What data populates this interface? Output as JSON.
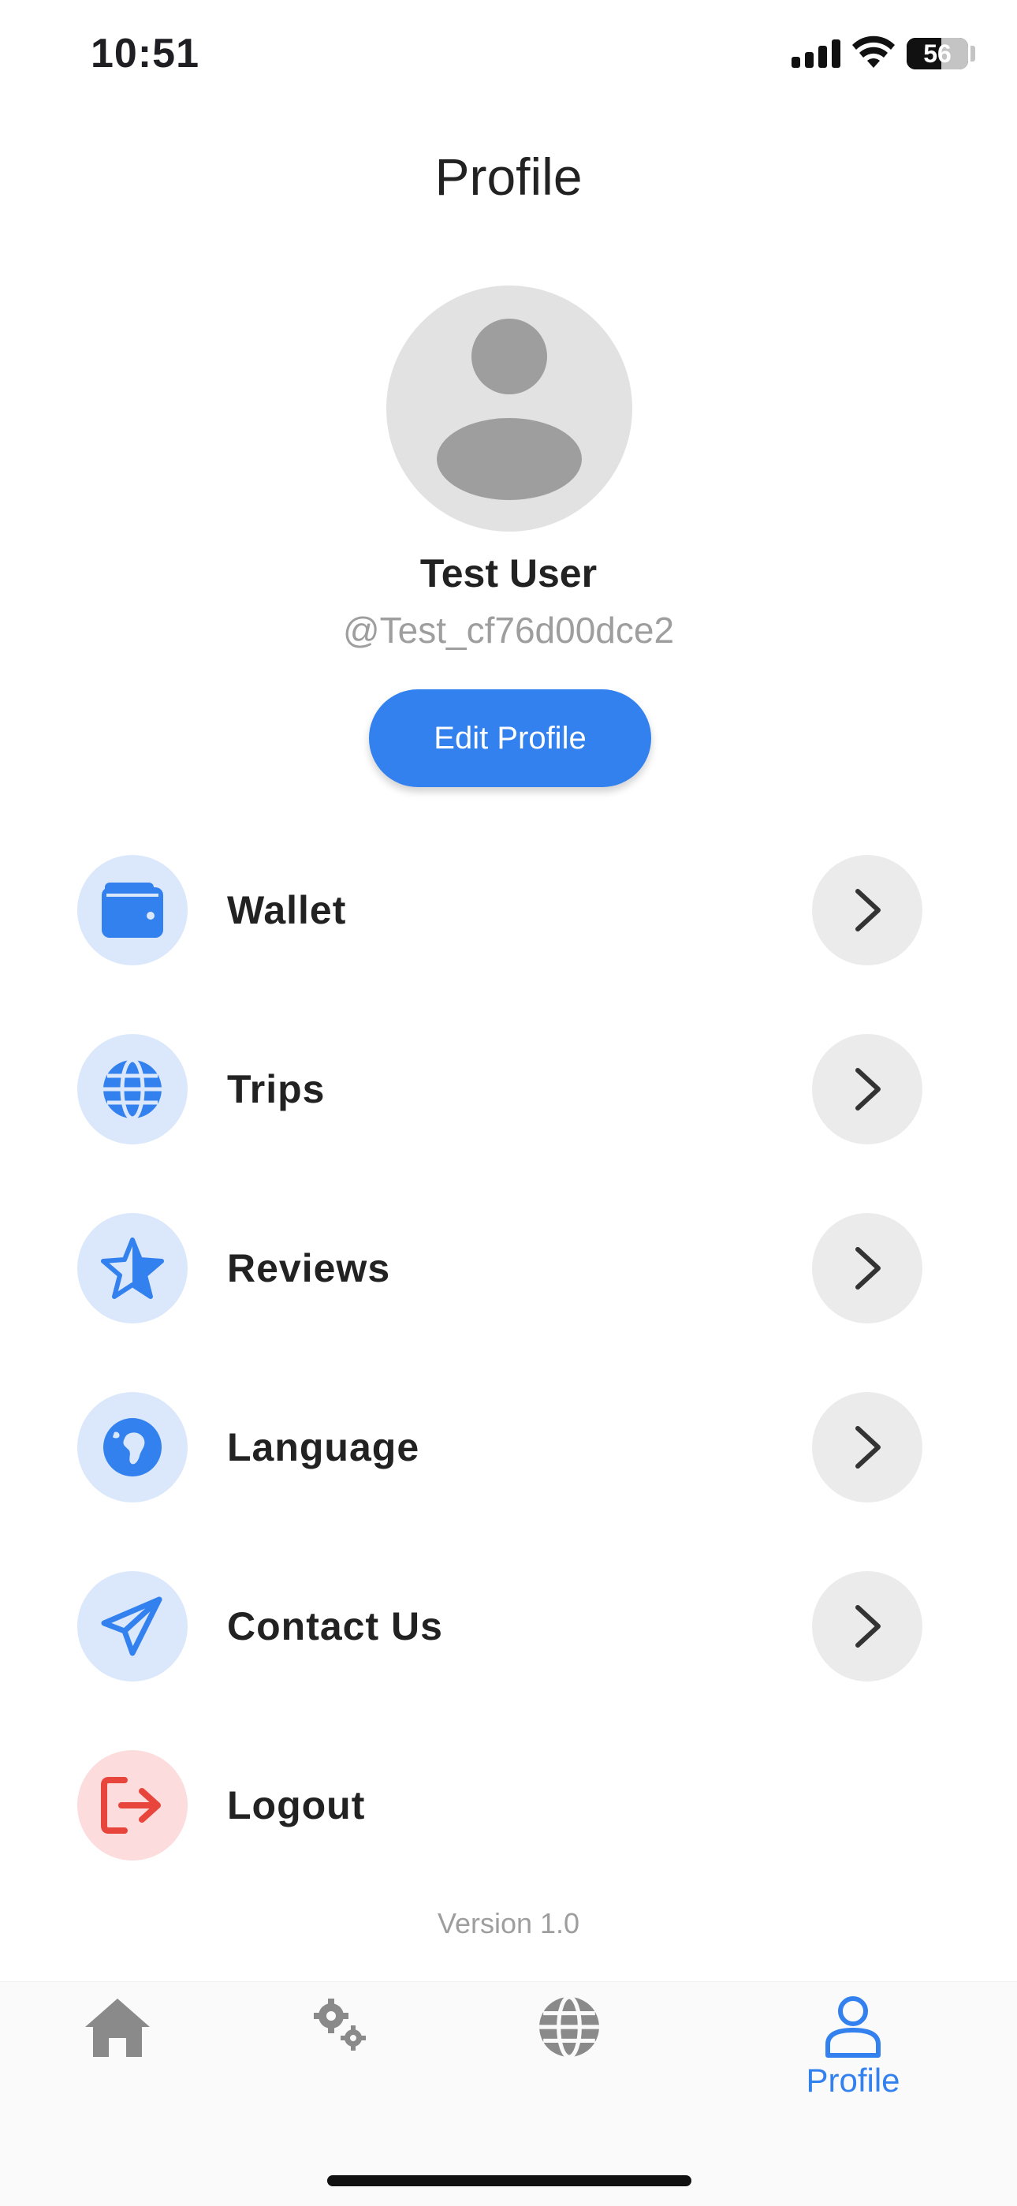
{
  "status_bar": {
    "time": "10:51",
    "battery": "56"
  },
  "header": {
    "title": "Profile"
  },
  "profile": {
    "name": "Test User",
    "handle": "@Test_cf76d00dce2",
    "edit_label": "Edit Profile"
  },
  "menu": {
    "items": [
      {
        "label": "Wallet",
        "icon": "wallet-icon"
      },
      {
        "label": "Trips",
        "icon": "globe-icon"
      },
      {
        "label": "Reviews",
        "icon": "star-icon"
      },
      {
        "label": "Language",
        "icon": "earth-icon"
      },
      {
        "label": "Contact Us",
        "icon": "paper-plane-icon"
      },
      {
        "label": "Logout",
        "icon": "logout-icon"
      }
    ]
  },
  "footer": {
    "version": "Version 1.0"
  },
  "tab_bar": {
    "tabs": [
      {
        "icon": "home-icon",
        "label": ""
      },
      {
        "icon": "gears-icon",
        "label": ""
      },
      {
        "icon": "globe-icon",
        "label": ""
      },
      {
        "icon": "person-icon",
        "label": "Profile",
        "active": true
      }
    ]
  },
  "colors": {
    "accent": "#3381ee",
    "icon_bg": "#dbe8fc",
    "danger": "#e8453c",
    "danger_bg": "#fcdcdc",
    "inactive_icon": "#8a8a8a"
  }
}
